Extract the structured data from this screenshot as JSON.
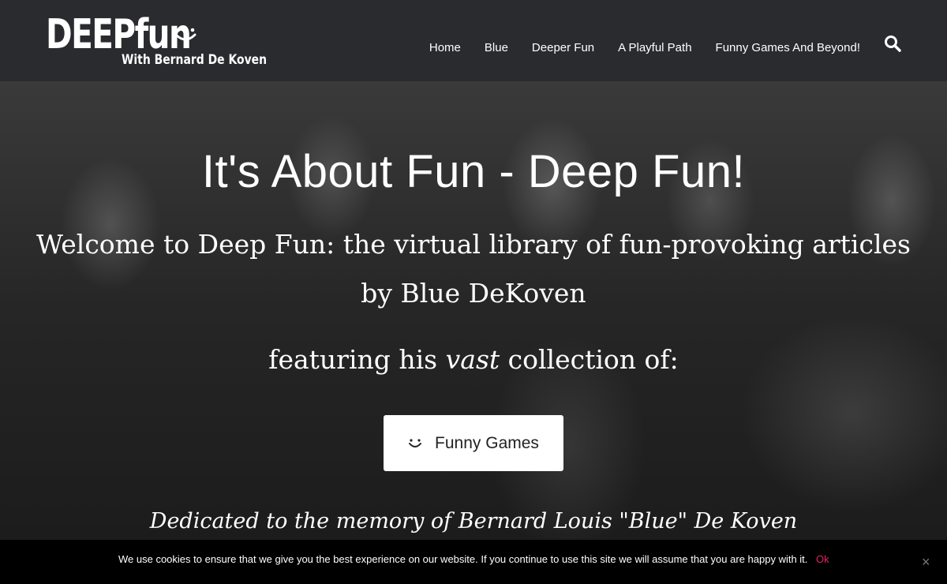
{
  "logo": {
    "main": "DEEPfun",
    "sub": "With Bernard De Koven"
  },
  "nav": [
    {
      "label": "Home"
    },
    {
      "label": "Blue"
    },
    {
      "label": "Deeper Fun"
    },
    {
      "label": "A Playful Path"
    },
    {
      "label": "Funny Games And Beyond!"
    }
  ],
  "hero": {
    "title": "It's About Fun - Deep Fun!",
    "line1": "Welcome to Deep Fun: the virtual library of fun-provoking articles",
    "line2": "by Blue DeKoven",
    "line3_before": "featuring his ",
    "line3_emph": "vast",
    "line3_after": " collection of:",
    "cta_label": "Funny Games",
    "dedication": "Dedicated to the memory of Bernard Louis \"Blue\" De Koven"
  },
  "cookie": {
    "text": "We use cookies to ensure that we give you the best experience on our website. If you continue to use this site we will assume that you are happy with it.",
    "ok_label": "Ok",
    "close_label": "×"
  },
  "colors": {
    "header_bg": "#2a2b2f",
    "cookie_ok": "#e0245e",
    "cookie_bg": "#000000"
  }
}
